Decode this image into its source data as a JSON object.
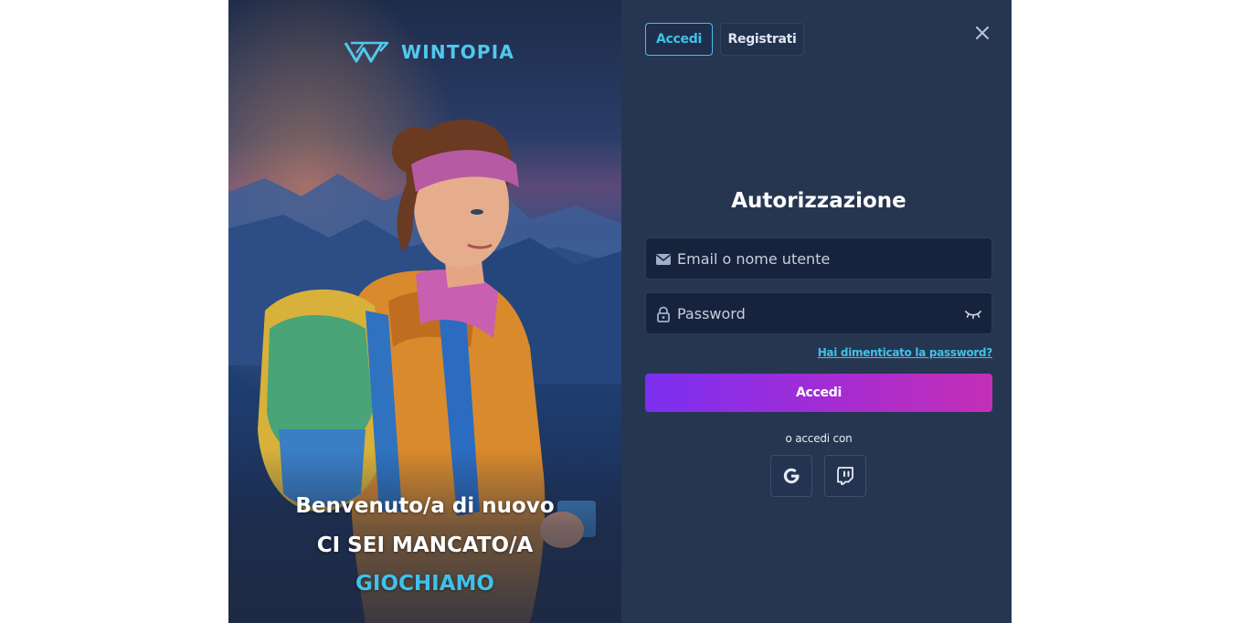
{
  "brand": {
    "name_part1": "W",
    "name_part2": "INTOPIA",
    "accent_color": "#3fc1ea"
  },
  "hero": {
    "line1": "Benvenuto/a di nuovo",
    "line2": "CI SEI MANCATO/A",
    "line3": "GIOCHIAMO"
  },
  "tabs": [
    {
      "label": "Accedi",
      "active": true
    },
    {
      "label": "Registrati",
      "active": false
    }
  ],
  "form": {
    "title": "Autorizzazione",
    "email_placeholder": "Email o nome utente",
    "email_value": "",
    "password_placeholder": "Password",
    "password_value": "",
    "forgot_label": "Hai dimenticato la password?",
    "submit_label": "Accedi",
    "submit_gradient": [
      "#7b2ff0",
      "#c42fb6"
    ],
    "or_label": "o accedi con"
  },
  "social": [
    {
      "name": "google",
      "icon": "google-icon"
    },
    {
      "name": "twitch",
      "icon": "twitch-icon"
    }
  ],
  "icons": {
    "close": "close-icon",
    "email": "envelope-icon",
    "password": "lock-icon",
    "toggle_password": "eye-closed-icon"
  }
}
